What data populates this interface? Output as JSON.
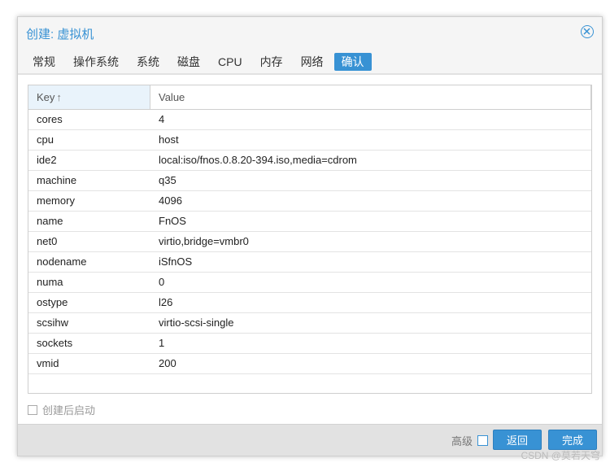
{
  "dialog": {
    "title": "创建: 虚拟机",
    "tabs": [
      {
        "label": "常规",
        "active": false
      },
      {
        "label": "操作系统",
        "active": false
      },
      {
        "label": "系统",
        "active": false
      },
      {
        "label": "磁盘",
        "active": false
      },
      {
        "label": "CPU",
        "active": false
      },
      {
        "label": "内存",
        "active": false
      },
      {
        "label": "网络",
        "active": false
      },
      {
        "label": "确认",
        "active": true
      }
    ]
  },
  "grid": {
    "key_header": "Key",
    "key_sort_icon": "arrow-up",
    "value_header": "Value",
    "rows": [
      {
        "key": "cores",
        "value": "4"
      },
      {
        "key": "cpu",
        "value": "host"
      },
      {
        "key": "ide2",
        "value": "local:iso/fnos.0.8.20-394.iso,media=cdrom"
      },
      {
        "key": "machine",
        "value": "q35"
      },
      {
        "key": "memory",
        "value": "4096"
      },
      {
        "key": "name",
        "value": "FnOS"
      },
      {
        "key": "net0",
        "value": "virtio,bridge=vmbr0"
      },
      {
        "key": "nodename",
        "value": "iSfnOS"
      },
      {
        "key": "numa",
        "value": "0"
      },
      {
        "key": "ostype",
        "value": "l26"
      },
      {
        "key": "scsihw",
        "value": "virtio-scsi-single"
      },
      {
        "key": "sockets",
        "value": "1"
      },
      {
        "key": "vmid",
        "value": "200"
      }
    ]
  },
  "options": {
    "start_after_create_label": "创建后启动",
    "start_after_create_checked": false
  },
  "footer": {
    "advanced_label": "高级",
    "advanced_checked": false,
    "back_label": "返回",
    "finish_label": "完成"
  },
  "watermark": "CSDN @莫若天穹",
  "colors": {
    "accent": "#3892d4",
    "header_sorted_bg": "#e9f3fb",
    "footer_bg": "#e2e2e2"
  }
}
